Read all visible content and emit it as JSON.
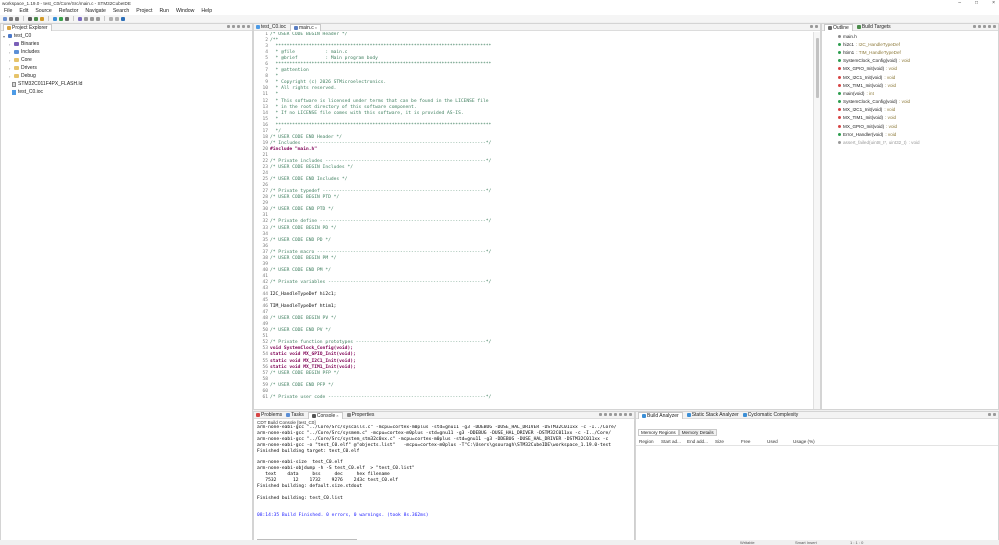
{
  "window": {
    "title": "workspace_1.19.0 - test_C0/Core/Src/main.c - STM32CubeIDE",
    "controls": [
      "–",
      "□",
      "×"
    ]
  },
  "menu": [
    "File",
    "Edit",
    "Source",
    "Refactor",
    "Navigate",
    "Search",
    "Project",
    "Run",
    "Window",
    "Help"
  ],
  "explorer": {
    "tab_label": "Project Explorer",
    "root": "test_C0",
    "items": [
      "Binaries",
      "Includes",
      "Core",
      "Drivers",
      "Debug",
      "STM32C011F4PX_FLASH.ld",
      "test_C0.ioc"
    ]
  },
  "editor": {
    "tabs": [
      "test_C0.ioc",
      "main.c"
    ],
    "lines": [
      {
        "n": "1",
        "t": "/* USER CODE BEGIN Header */",
        "c": "comment"
      },
      {
        "n": "2",
        "t": "/**",
        "c": "comment"
      },
      {
        "n": "3",
        "t": "  ******************************************************************************",
        "c": "comment"
      },
      {
        "n": "4",
        "t": "  * @file           : main.c",
        "c": "comment"
      },
      {
        "n": "5",
        "t": "  * @brief          : Main program body",
        "c": "comment"
      },
      {
        "n": "6",
        "t": "  ******************************************************************************",
        "c": "comment"
      },
      {
        "n": "7",
        "t": "  * @attention",
        "c": "comment"
      },
      {
        "n": "8",
        "t": "  *",
        "c": "comment"
      },
      {
        "n": "9",
        "t": "  * Copyright (c) 2026 STMicroelectronics.",
        "c": "comment"
      },
      {
        "n": "10",
        "t": "  * All rights reserved.",
        "c": "comment"
      },
      {
        "n": "11",
        "t": "  *",
        "c": "comment"
      },
      {
        "n": "12",
        "t": "  * This software is licensed under terms that can be found in the LICENSE file",
        "c": "comment"
      },
      {
        "n": "13",
        "t": "  * in the root directory of this software component.",
        "c": "comment"
      },
      {
        "n": "14",
        "t": "  * If no LICENSE file comes with this software, it is provided AS-IS.",
        "c": "comment"
      },
      {
        "n": "15",
        "t": "  *",
        "c": "comment"
      },
      {
        "n": "16",
        "t": "  ******************************************************************************",
        "c": "comment"
      },
      {
        "n": "17",
        "t": "  */",
        "c": "comment"
      },
      {
        "n": "18",
        "t": "/* USER CODE END Header */",
        "c": "comment"
      },
      {
        "n": "19",
        "t": "/* Includes ------------------------------------------------------------------*/",
        "c": "comment"
      },
      {
        "n": "20",
        "t": "#include \"main.h\"",
        "c": "incl"
      },
      {
        "n": "21",
        "t": "",
        "c": "plain"
      },
      {
        "n": "22",
        "t": "/* Private includes ----------------------------------------------------------*/",
        "c": "comment"
      },
      {
        "n": "23",
        "t": "/* USER CODE BEGIN Includes */",
        "c": "comment"
      },
      {
        "n": "24",
        "t": "",
        "c": "plain"
      },
      {
        "n": "25",
        "t": "/* USER CODE END Includes */",
        "c": "comment"
      },
      {
        "n": "26",
        "t": "",
        "c": "plain"
      },
      {
        "n": "27",
        "t": "/* Private typedef -----------------------------------------------------------*/",
        "c": "comment"
      },
      {
        "n": "28",
        "t": "/* USER CODE BEGIN PTD */",
        "c": "comment"
      },
      {
        "n": "29",
        "t": "",
        "c": "plain"
      },
      {
        "n": "30",
        "t": "/* USER CODE END PTD */",
        "c": "comment"
      },
      {
        "n": "31",
        "t": "",
        "c": "plain"
      },
      {
        "n": "32",
        "t": "/* Private define ------------------------------------------------------------*/",
        "c": "comment"
      },
      {
        "n": "33",
        "t": "/* USER CODE BEGIN PD */",
        "c": "comment"
      },
      {
        "n": "34",
        "t": "",
        "c": "plain"
      },
      {
        "n": "35",
        "t": "/* USER CODE END PD */",
        "c": "comment"
      },
      {
        "n": "36",
        "t": "",
        "c": "plain"
      },
      {
        "n": "37",
        "t": "/* Private macro -------------------------------------------------------------*/",
        "c": "comment"
      },
      {
        "n": "38",
        "t": "/* USER CODE BEGIN PM */",
        "c": "comment"
      },
      {
        "n": "39",
        "t": "",
        "c": "plain"
      },
      {
        "n": "40",
        "t": "/* USER CODE END PM */",
        "c": "comment"
      },
      {
        "n": "41",
        "t": "",
        "c": "plain"
      },
      {
        "n": "42",
        "t": "/* Private variables ---------------------------------------------------------*/",
        "c": "comment"
      },
      {
        "n": "43",
        "t": "",
        "c": "plain"
      },
      {
        "n": "44",
        "t": "I2C_HandleTypeDef hi2c1;",
        "c": "plain"
      },
      {
        "n": "45",
        "t": "",
        "c": "plain"
      },
      {
        "n": "46",
        "t": "TIM_HandleTypeDef htim1;",
        "c": "plain"
      },
      {
        "n": "47",
        "t": "",
        "c": "plain"
      },
      {
        "n": "48",
        "t": "/* USER CODE BEGIN PV */",
        "c": "comment"
      },
      {
        "n": "49",
        "t": "",
        "c": "plain"
      },
      {
        "n": "50",
        "t": "/* USER CODE END PV */",
        "c": "comment"
      },
      {
        "n": "51",
        "t": "",
        "c": "plain"
      },
      {
        "n": "52",
        "t": "/* Private function prototypes -----------------------------------------------*/",
        "c": "comment"
      },
      {
        "n": "53",
        "t": "void SystemClock_Config(void);",
        "c": "kw"
      },
      {
        "n": "54",
        "t": "static void MX_GPIO_Init(void);",
        "c": "kw"
      },
      {
        "n": "55",
        "t": "static void MX_I2C1_Init(void);",
        "c": "kw"
      },
      {
        "n": "56",
        "t": "static void MX_TIM1_Init(void);",
        "c": "kw"
      },
      {
        "n": "57",
        "t": "/* USER CODE BEGIN PFP */",
        "c": "comment"
      },
      {
        "n": "58",
        "t": "",
        "c": "plain"
      },
      {
        "n": "59",
        "t": "/* USER CODE END PFP */",
        "c": "comment"
      },
      {
        "n": "60",
        "t": "",
        "c": "plain"
      },
      {
        "n": "61",
        "t": "/* Private user code ---------------------------------------------------------*/",
        "c": "comment"
      }
    ]
  },
  "outline": {
    "tabs": [
      "Outline",
      "Build Targets"
    ],
    "items": [
      {
        "name": "main.h",
        "type": "",
        "color": "#8a8a8a",
        "dim": false
      },
      {
        "name": "hi2c1",
        "type": ": I2C_HandleTypeDef",
        "color": "#2e9e4f",
        "dim": false
      },
      {
        "name": "htim1",
        "type": ": TIM_HandleTypeDef",
        "color": "#2e9e4f",
        "dim": false
      },
      {
        "name": "SystemClock_Config(void)",
        "type": ": void",
        "color": "#2e9e4f",
        "dim": false
      },
      {
        "name": "MX_GPIO_Init(void)",
        "type": ": void",
        "color": "#d64545",
        "dim": false
      },
      {
        "name": "MX_I2C1_Init(void)",
        "type": ": void",
        "color": "#d64545",
        "dim": false
      },
      {
        "name": "MX_TIM1_Init(void)",
        "type": ": void",
        "color": "#d64545",
        "dim": false
      },
      {
        "name": "main(void)",
        "type": ": int",
        "color": "#2e9e4f",
        "dim": false
      },
      {
        "name": "SystemClock_Config(void)",
        "type": ": void",
        "color": "#2e9e4f",
        "dim": false
      },
      {
        "name": "MX_I2C1_Init(void)",
        "type": ": void",
        "color": "#d64545",
        "dim": false
      },
      {
        "name": "MX_TIM1_Init(void)",
        "type": ": void",
        "color": "#d64545",
        "dim": false
      },
      {
        "name": "MX_GPIO_Init(void)",
        "type": ": void",
        "color": "#d64545",
        "dim": false
      },
      {
        "name": "Error_Handler(void)",
        "type": ": void",
        "color": "#2e9e4f",
        "dim": false
      },
      {
        "name": "assert_failed(uint8_t*, uint32_t)",
        "type": ": void",
        "color": "#9a9a9a",
        "dim": true
      }
    ]
  },
  "console": {
    "tabs": [
      "Problems",
      "Tasks",
      "Console",
      "Properties"
    ],
    "label": "CDT Build Console [test_C0]",
    "lines": [
      {
        "t": "arm-none-eabi-gcc \"../Core/Src/syscalls.c\" -mcpu=cortex-m0plus -std=gnu11 -g3 -DDEBUG -DUSE_HAL_DRIVER -DSTM32C011xx -c -I../Core/",
        "blue": false
      },
      {
        "t": "arm-none-eabi-gcc \"../Core/Src/sysmem.c\" -mcpu=cortex-m0plus -std=gnu11 -g3 -DDEBUG -DUSE_HAL_DRIVER -DSTM32C011xx -c -I../Core/",
        "blue": false
      },
      {
        "t": "arm-none-eabi-gcc \"../Core/Src/system_stm32c0xx.c\" -mcpu=cortex-m0plus -std=gnu11 -g3 -DDEBUG -DUSE_HAL_DRIVER -DSTM32C011xx -c",
        "blue": false
      },
      {
        "t": "arm-none-eabi-gcc -o \"test_C0.elf\" @\"objects.list\"   -mcpu=cortex-m0plus -T\"C:\\Users\\gsouragh\\STM32CubeIDE\\workspace_1.19.0-test",
        "blue": false
      },
      {
        "t": "Finished building target: test_C0.elf",
        "blue": false
      },
      {
        "t": "",
        "blue": false
      },
      {
        "t": "arm-none-eabi-size  test_C0.elf",
        "blue": false
      },
      {
        "t": "arm-none-eabi-objdump -h -S test_C0.elf  > \"test_C0.list\"",
        "blue": false
      },
      {
        "t": "   text    data     bss     dec     hex filename",
        "blue": false
      },
      {
        "t": "   7532      12    1732    9276    243c test_C0.elf",
        "blue": false
      },
      {
        "t": "Finished building: default.size.stdout",
        "blue": false
      },
      {
        "t": "",
        "blue": false
      },
      {
        "t": "Finished building: test_C0.list",
        "blue": false
      },
      {
        "t": "",
        "blue": false
      },
      {
        "t": "",
        "blue": false
      },
      {
        "t": "08:14:35 Build Finished. 0 errors, 0 warnings. (took 8s.362ms)",
        "blue": true
      }
    ]
  },
  "analyzer": {
    "tabs": [
      "Build Analyzer",
      "Static Stack Analyzer",
      "Cyclomatic Complexity"
    ],
    "subtabs": [
      "Memory Regions",
      "Memory Details"
    ],
    "columns": [
      "Region",
      "Start ad...",
      "End add...",
      "Size",
      "Free",
      "Used",
      "Usage (%)"
    ]
  },
  "status": {
    "left": "Writable",
    "middle": "Smart Insert",
    "right": "1 : 1 : 0"
  },
  "colors": {
    "comment": "#3f7f5f",
    "keyword": "#7f0055",
    "console_blue": "#1a1aff",
    "selection_tab": "#ffffff"
  }
}
